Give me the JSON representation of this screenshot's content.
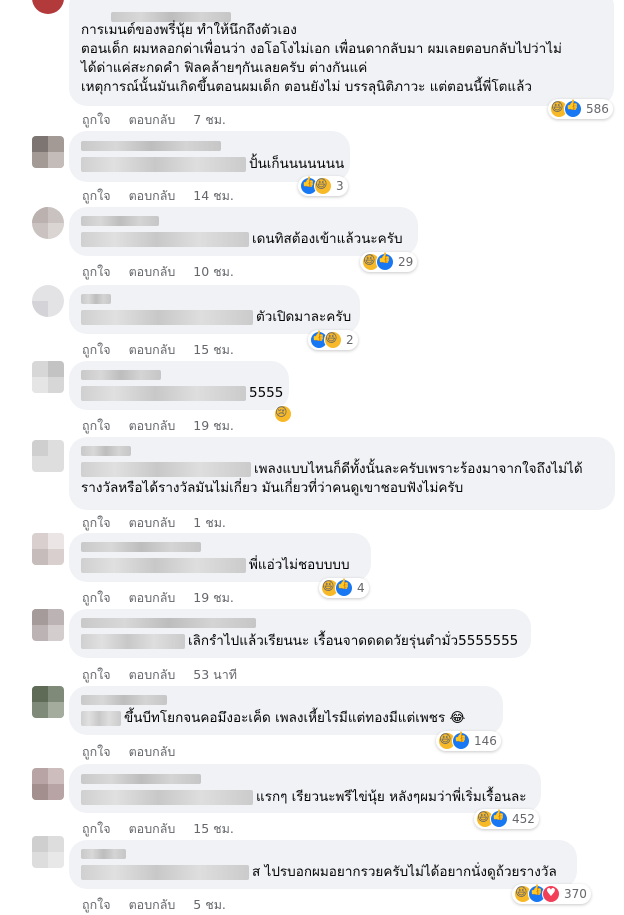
{
  "labels": {
    "like": "ถูกใจ",
    "reply": "ตอบกลับ"
  },
  "comments": [
    {
      "lines": [
        "การเมนต์ของพรี่นุ้ย ทำให้นึกถึงตัวเอง",
        "ตอนเด็ก ผมหลอกด่าเพื่อนว่า งอโอโงไม่เอก เพื่อนดากลับมา ผมเลยตอบกลับไปว่าไม่",
        "ได้ด่าแค่สะกดคำ ฟิลคล้ายๆกันเลยครับ ต่างกันแค่",
        "เหตุการณ์นั้นมันเกิดขึ้นตอนผมเด็ก ตอนยังไม่ บรรลุนิติภาวะ แต่ตอนนี้พี่โตแล้ว"
      ],
      "time": "7 ชม.",
      "reactions": [
        "haha",
        "like"
      ],
      "count": "586"
    },
    {
      "text": "ปั้นเก็นนนนนนน",
      "time": "14 ชม.",
      "reactions": [
        "like",
        "haha"
      ],
      "count": "3"
    },
    {
      "text": "เดนทิสต้องเข้าแล้วนะครับ",
      "time": "10 ชม.",
      "reactions": [
        "haha",
        "like"
      ],
      "count": "29"
    },
    {
      "text": "ตัวเปิดมาละครับ",
      "time": "15 ชม.",
      "reactions": [
        "like",
        "haha"
      ],
      "count": "2"
    },
    {
      "text": "5555",
      "time": "19 ชม.",
      "reactions": [
        "sad"
      ],
      "count": ""
    },
    {
      "lines": [
        "เพลงแบบไหนก็ดีทั้งนั้นละครับเพราะร้องมาจากใจถึงไม่ได้",
        "รางวัลหรือได้รางวัลมันไม่เกี่ยว มันเกี่ยวที่ว่าคนดูเขาชอบฟังไม่ครับ"
      ],
      "time": "1 ชม.",
      "reactions": [],
      "count": ""
    },
    {
      "text": "พี่แอ่วไม่ชอบบบบ",
      "time": "19 ชม.",
      "reactions": [
        "haha",
        "like"
      ],
      "count": "4"
    },
    {
      "text": "เลิกรำไปแล้วเรียนนะ เรื้อนจาดดดดวัยรุ่นตำมั่ว5555555",
      "time": "53 นาที",
      "reactions": [],
      "count": ""
    },
    {
      "text": "ขึ้นบีทโยกจนคอมึงอะเค็ด เพลงเหี้ยไรมีแต่ทองมีแต่เพชร 😂",
      "time": "",
      "reactions": [
        "haha",
        "like"
      ],
      "count": "146"
    },
    {
      "text": "แรกๆ เรียวนะพรีไข่นุ้ย หลังๆผมว่าพี่เริ่มเรื้อนละ",
      "time": "15 ชม.",
      "reactions": [
        "haha",
        "like"
      ],
      "count": "452"
    },
    {
      "text": "ส ไปรบอกผมอยากรวยครับไม่ได้อยากนั่งดูถ้วยรางวัล",
      "time": "5 ชม.",
      "reactions": [
        "haha",
        "like",
        "love"
      ],
      "count": "370"
    }
  ]
}
